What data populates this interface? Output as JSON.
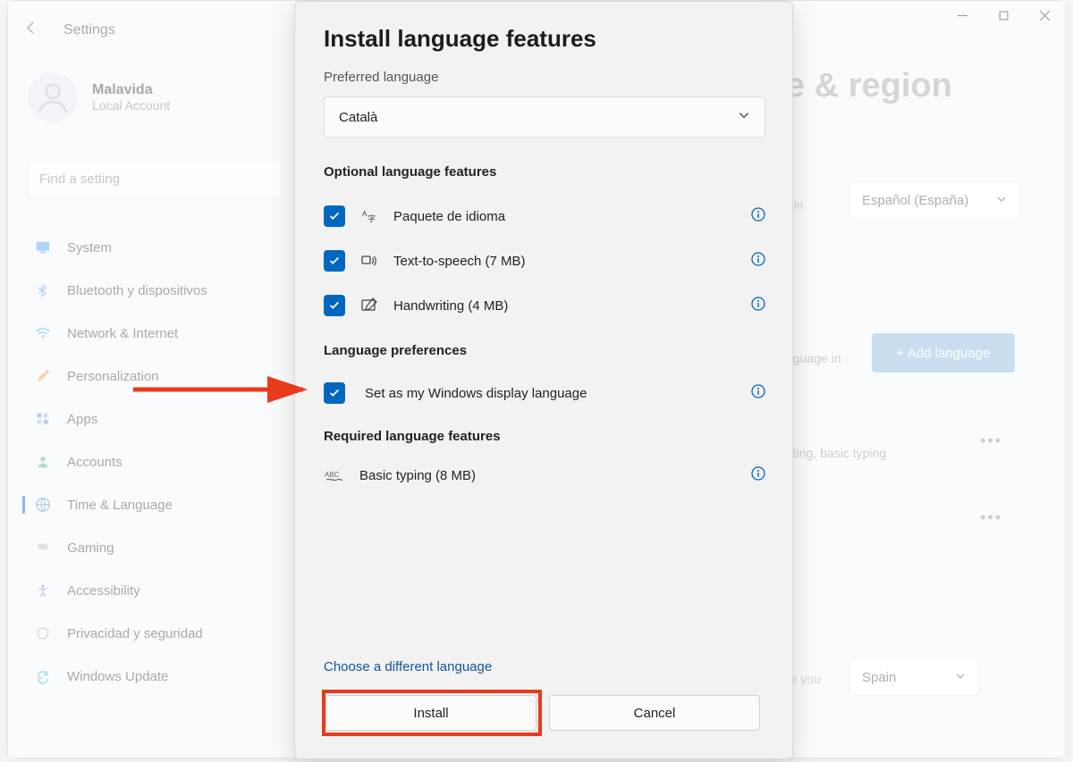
{
  "top": {
    "settings": "Settings"
  },
  "user": {
    "name": "Malavida",
    "sub": "Local Account"
  },
  "search": {
    "placeholder": "Find a setting"
  },
  "sidebar": {
    "items": [
      {
        "label": "System"
      },
      {
        "label": "Bluetooth y dispositivos"
      },
      {
        "label": "Network & Internet"
      },
      {
        "label": "Personalization"
      },
      {
        "label": "Apps"
      },
      {
        "label": "Accounts"
      },
      {
        "label": "Time & Language"
      },
      {
        "label": "Gaming"
      },
      {
        "label": "Accessibility"
      },
      {
        "label": "Privacidad y seguridad"
      },
      {
        "label": "Windows Update"
      }
    ]
  },
  "main": {
    "title": "e & region",
    "displayLangText": "r in",
    "displayLang": "Español (España)",
    "addLanguage": "+ Add language",
    "prefText": "nguage in",
    "row2sub": "riting, basic typing",
    "regionText": "re you",
    "country": "Spain"
  },
  "dialog": {
    "title": "Install language features",
    "prefLabel": "Preferred language",
    "language": "Català",
    "sections": {
      "optional": "Optional language features",
      "prefs": "Language preferences",
      "required": "Required language features"
    },
    "opts": {
      "pack": "Paquete de idioma",
      "tts": "Text-to-speech (7 MB)",
      "hand": "Handwriting (4 MB)",
      "display": "Set as my Windows display language",
      "basic": "Basic typing (8 MB)"
    },
    "link": "Choose a different language",
    "install": "Install",
    "cancel": "Cancel"
  }
}
